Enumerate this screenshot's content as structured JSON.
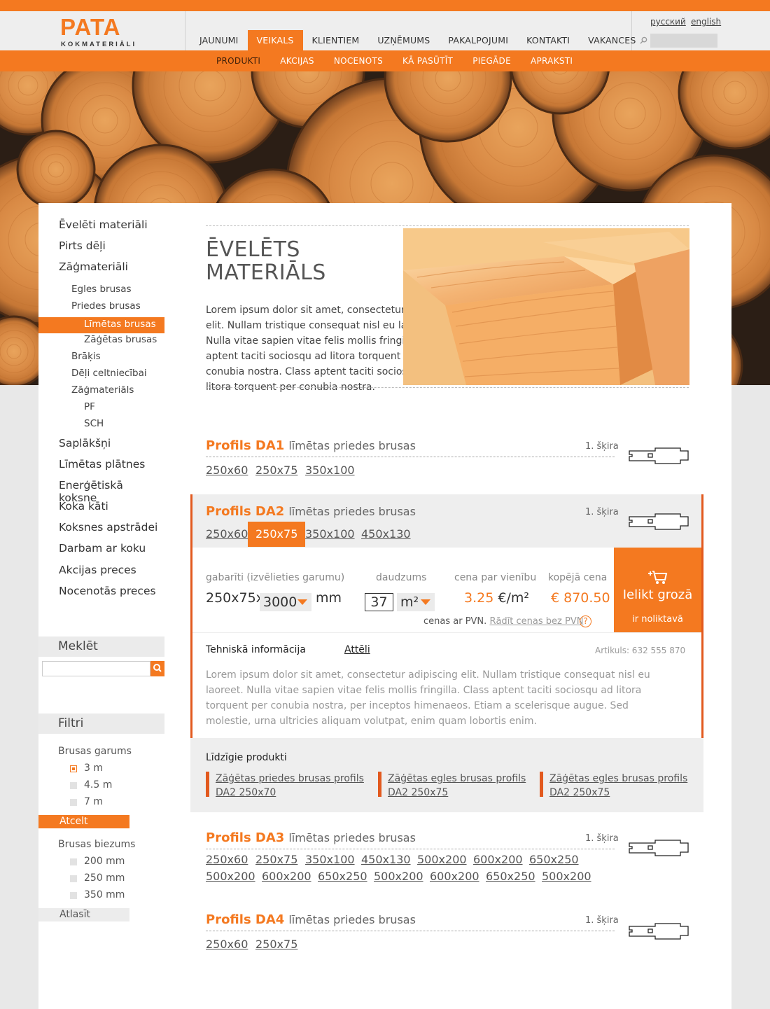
{
  "brand": {
    "name": "PATA",
    "sub": "KOKMATERIĀLI"
  },
  "lang": {
    "ru": "русский",
    "en": "english"
  },
  "colors": {
    "accent": "#f47920",
    "accent_dark": "#e2591e"
  },
  "main_nav": [
    "JAUNUMI",
    "VEIKALS",
    "KLIENTIEM",
    "UZŅĒMUMS",
    "PAKALPOJUMI",
    "KONTAKTI",
    "VAKANCES"
  ],
  "main_nav_active": "VEIKALS",
  "sub_nav": [
    "PRODUKTI",
    "AKCIJAS",
    "NOCENOTS",
    "KĀ PASŪTĪT",
    "PIEGĀDE",
    "APRAKSTI"
  ],
  "sub_nav_active": "PRODUKTI",
  "sidebar": {
    "items": [
      {
        "label": "Ēvelēti materiāli",
        "level": 1
      },
      {
        "label": "Pirts dēļi",
        "level": 1
      },
      {
        "label": "Zāģmateriāli",
        "level": 1
      },
      {
        "label": "Egles brusas",
        "level": 2
      },
      {
        "label": "Priedes brusas",
        "level": 2
      },
      {
        "label": "Līmētas brusas",
        "level": 3,
        "active": true
      },
      {
        "label": "Zāģētas brusas",
        "level": 3
      },
      {
        "label": "Brāķis",
        "level": 2
      },
      {
        "label": "Dēļi celtniecībai",
        "level": 2
      },
      {
        "label": "Zāģmateriāls",
        "level": 2
      },
      {
        "label": "PF",
        "level": 3
      },
      {
        "label": "SCH",
        "level": 3
      },
      {
        "label": "Saplākšņi",
        "level": 1
      },
      {
        "label": "Līmētas plātnes",
        "level": 1
      },
      {
        "label": "Enerģētiskā koksne",
        "level": 1
      },
      {
        "label": "Koka kāti",
        "level": 1
      },
      {
        "label": "Koksnes apstrādei",
        "level": 1
      },
      {
        "label": "Darbam ar koku",
        "level": 1
      },
      {
        "label": "Akcijas preces",
        "level": 1
      },
      {
        "label": "Nocenotās preces",
        "level": 1
      }
    ],
    "search_title": "Meklēt",
    "filter_title": "Filtri",
    "filter_length": {
      "label": "Brusas garums",
      "options": [
        "3 m",
        "4.5 m",
        "7 m"
      ],
      "checked": [
        true,
        false,
        false
      ]
    },
    "reset": "Atcelt",
    "filter_thickness": {
      "label": "Brusas biezums",
      "options": [
        "200 mm",
        "250 mm",
        "350 mm"
      ],
      "checked": [
        false,
        false,
        false
      ]
    },
    "apply": "Atlasīt"
  },
  "page": {
    "title_line1": "ĒVELĒTS",
    "title_line2": "MATERIĀLS",
    "intro": "Lorem ipsum dolor sit amet, consectetur adipiscing elit. Nullam tristique consequat nisl eu laoreet. Nulla vitae sapien vitae felis mollis fringilla. Class aptent taciti sociosqu ad litora torquent per conubia nostra. Class aptent taciti sociosqu ad litora torquent per conubia nostra."
  },
  "products": [
    {
      "name": "Profils DA1",
      "desc": "līmētas priedes brusas",
      "grade": "1. šķira",
      "sizes": [
        "250x60",
        "250x75",
        "350x100"
      ]
    },
    {
      "name": "Profils DA2",
      "desc": "līmētas priedes brusas",
      "grade": "1. šķira",
      "sizes": [
        "250x60",
        "250x75",
        "350x100",
        "450x130"
      ],
      "active_size": "250x75"
    },
    {
      "name": "Profils DA3",
      "desc": "līmētas priedes brusas",
      "grade": "1. šķira",
      "sizes": [
        "250x60",
        "250x75",
        "350x100",
        "450x130",
        "500x200",
        "600x200",
        "650x250",
        "500x200",
        "600x200",
        "650x250",
        "500x200",
        "600x200",
        "650x250",
        "500x200"
      ]
    },
    {
      "name": "Profils DA4",
      "desc": "līmētas priedes brusas",
      "grade": "1. šķira",
      "sizes": [
        "250x60",
        "250x75"
      ]
    }
  ],
  "detail": {
    "dim_label": "gabarīti (izvēlieties garumu)",
    "dim_value": "250x75x",
    "length": "3000",
    "length_unit": "mm",
    "qty_label": "daudzums",
    "qty": "37",
    "qty_unit": "m²",
    "unit_price_label": "cena par vienību",
    "unit_price": "3.25",
    "unit_price_unit": "€/m²",
    "total_label": "kopējā cena",
    "total": "€ 870.50",
    "vat_text": "cenas ar PVN.",
    "vat_link": "Rādīt cenas bez PVN",
    "help": "?",
    "cart_label": "Ielikt grozā",
    "stock": "ir noliktavā",
    "tab_tech": "Tehniskā informācija",
    "tab_images": "Attēli",
    "article": "Artikuls: 632 555 870",
    "description": "Lorem ipsum dolor sit amet, consectetur adipiscing elit. Nullam tristique consequat nisl eu laoreet. Nulla vitae sapien vitae felis mollis fringilla. Class aptent taciti sociosqu ad litora torquent per conubia nostra, per inceptos himenaeos. Etiam a scelerisque augue. Sed molestie, urna ultricies aliquam volutpat, enim quam lobortis enim."
  },
  "similar": {
    "title": "Līdzīgie produkti",
    "items": [
      {
        "line1": "Zāģētas priedes brusas profils",
        "line2": "DA2 250x70"
      },
      {
        "line1": "Zāģētas egles brusas profils",
        "line2": "DA2 250x75"
      },
      {
        "line1": "Zāģētas egles brusas profils",
        "line2": "DA2 250x75"
      }
    ]
  }
}
